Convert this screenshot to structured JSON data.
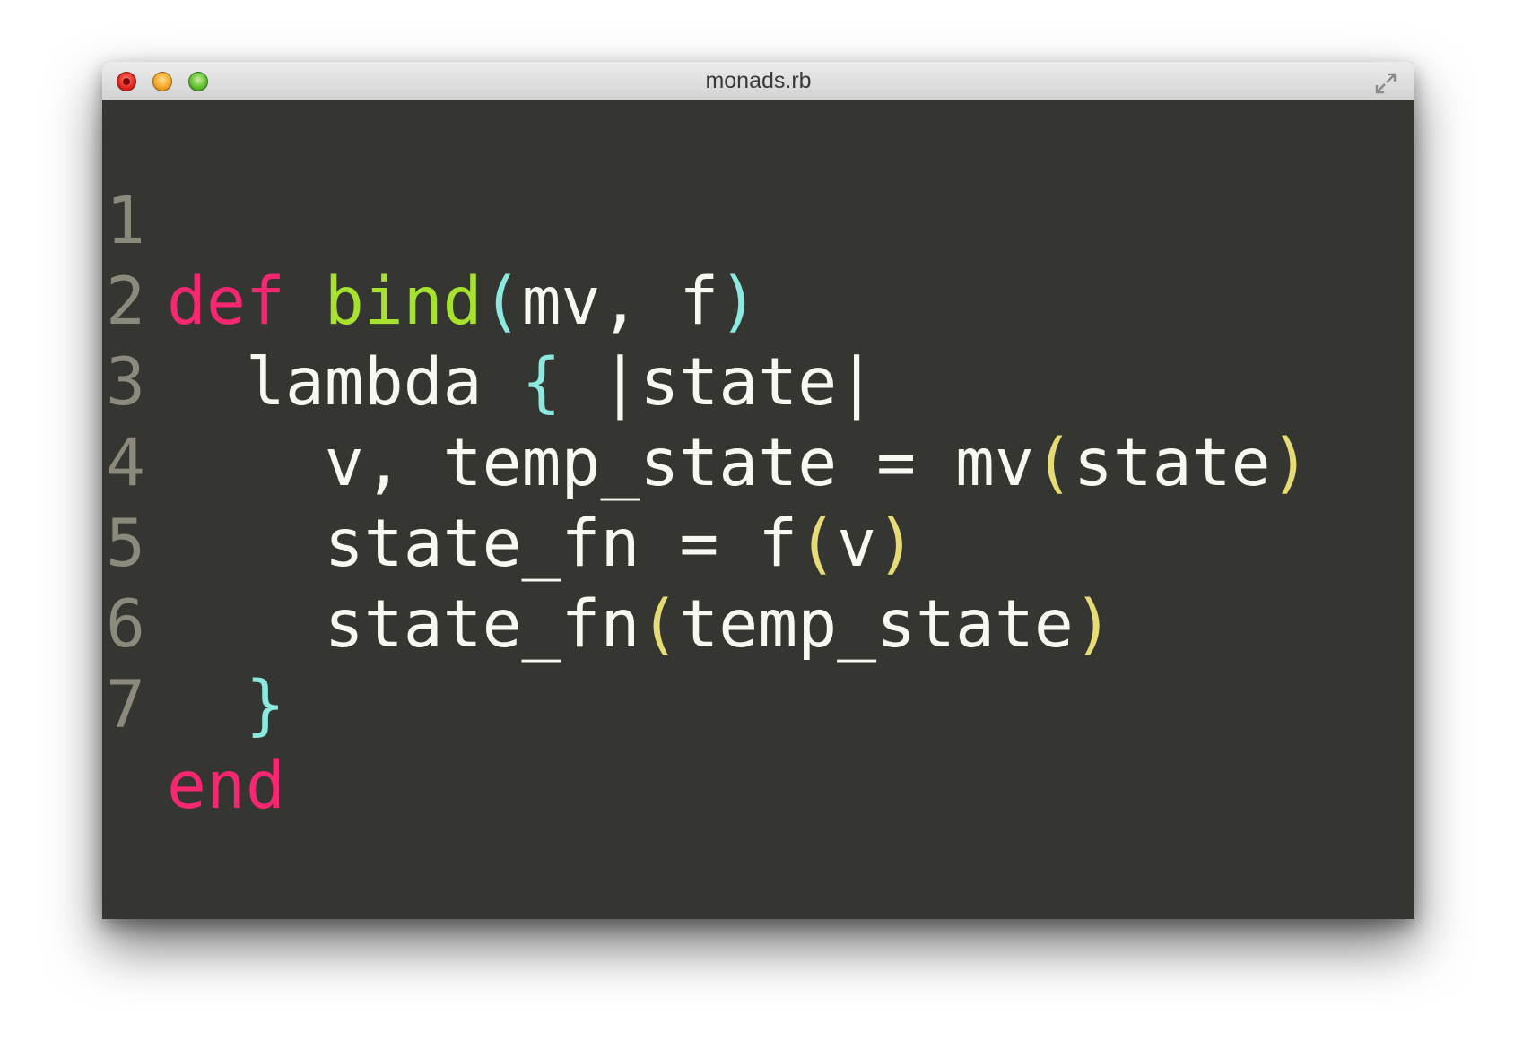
{
  "window": {
    "title": "monads.rb"
  },
  "editor": {
    "language": "ruby",
    "colors": {
      "background": "#353531",
      "keyword": "#f92672",
      "function_name": "#a6e22e",
      "text": "#f8f8f2",
      "paren_cyan": "#8be9e0",
      "paren_yellow": "#e6db74",
      "line_number": "#8b8a7c"
    },
    "lines": [
      {
        "number": "1",
        "tokens": [
          "def",
          " ",
          "bind",
          "(",
          "mv, f",
          ")"
        ]
      },
      {
        "number": "2",
        "tokens": [
          "  lambda ",
          "{",
          " |state|"
        ]
      },
      {
        "number": "3",
        "tokens": [
          "    v, temp_state = mv",
          "(",
          "state",
          ")"
        ]
      },
      {
        "number": "4",
        "tokens": [
          "    state_fn = f",
          "(",
          "v",
          ")"
        ]
      },
      {
        "number": "5",
        "tokens": [
          "    state_fn",
          "(",
          "temp_state",
          ")"
        ]
      },
      {
        "number": "6",
        "tokens": [
          "  ",
          "}"
        ]
      },
      {
        "number": "7",
        "tokens": [
          "end"
        ]
      }
    ]
  }
}
